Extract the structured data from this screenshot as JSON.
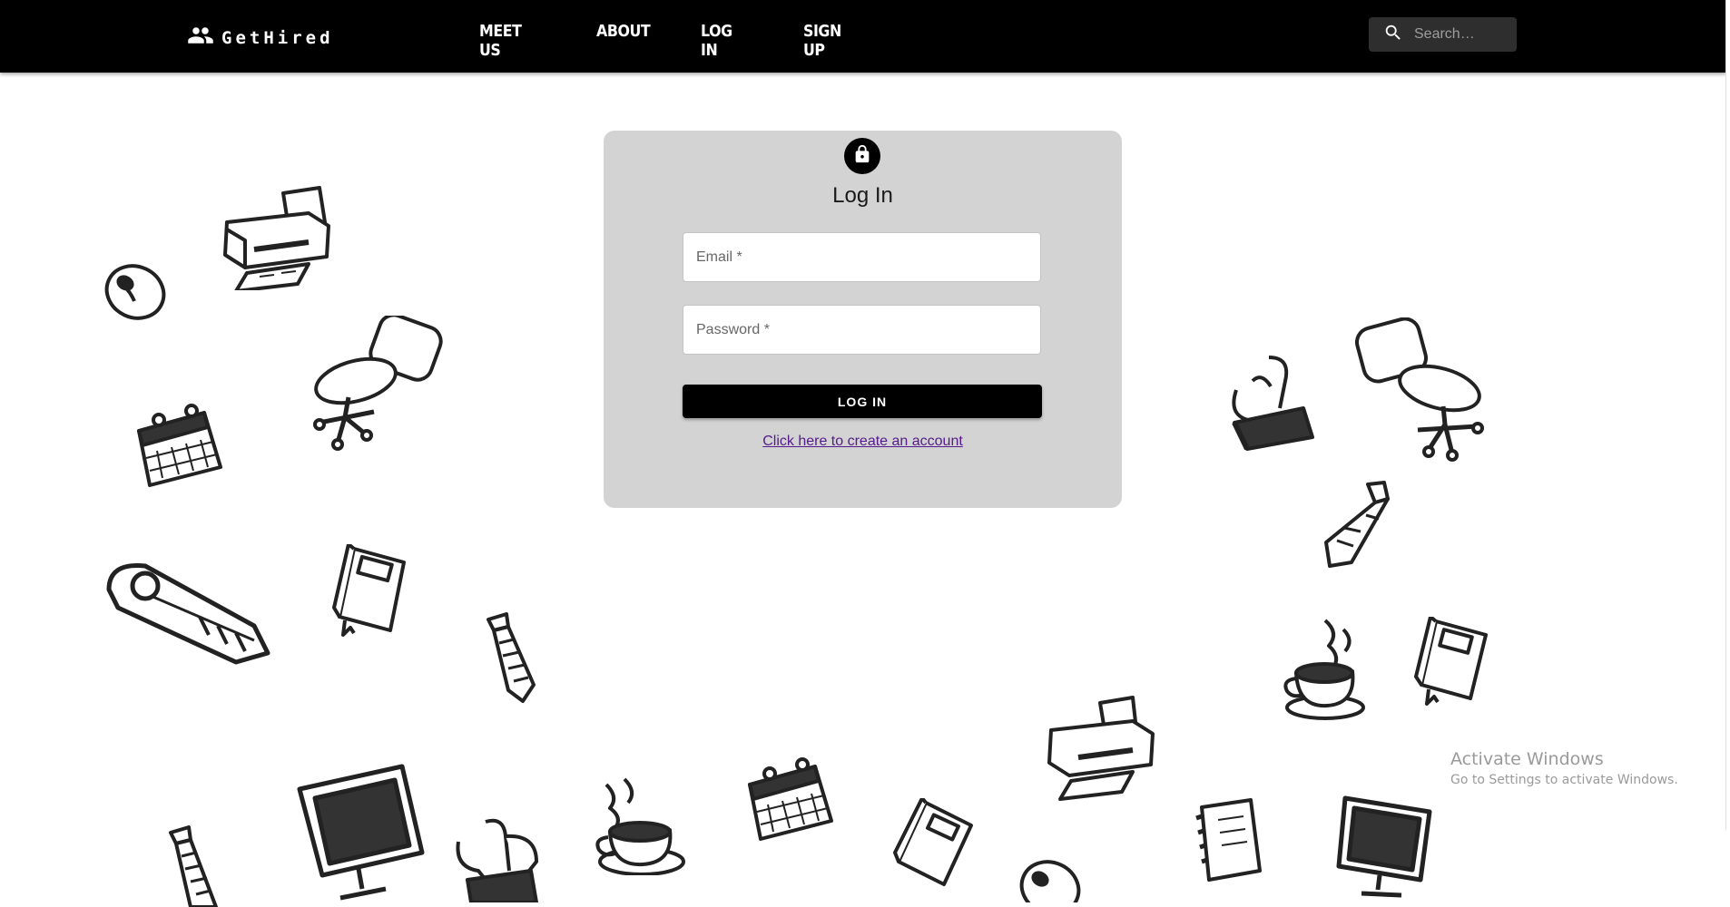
{
  "brand": {
    "name": "GetHired",
    "icon": "people-icon"
  },
  "nav": {
    "items": [
      "MEET US",
      "ABOUT",
      "LOG IN",
      "SIGN UP"
    ]
  },
  "search": {
    "placeholder": "Search…",
    "icon": "search-icon"
  },
  "login": {
    "icon": "lock-icon",
    "title": "Log In",
    "email_placeholder": "Email *",
    "password_placeholder": "Password *",
    "button_label": "LOG IN",
    "create_account_link": "Click here to create an account"
  },
  "watermark": {
    "title": "Activate Windows",
    "subtitle": "Go to Settings to activate Windows."
  },
  "colors": {
    "topbar": "#000000",
    "card": "#d3d3d3",
    "link": "#551a8b"
  },
  "background_doodles": [
    "printer",
    "mouse",
    "office-chair",
    "calendar",
    "box-cutter",
    "notebook",
    "tie",
    "monitor",
    "binder-clip",
    "coffee-cup",
    "notepad"
  ]
}
